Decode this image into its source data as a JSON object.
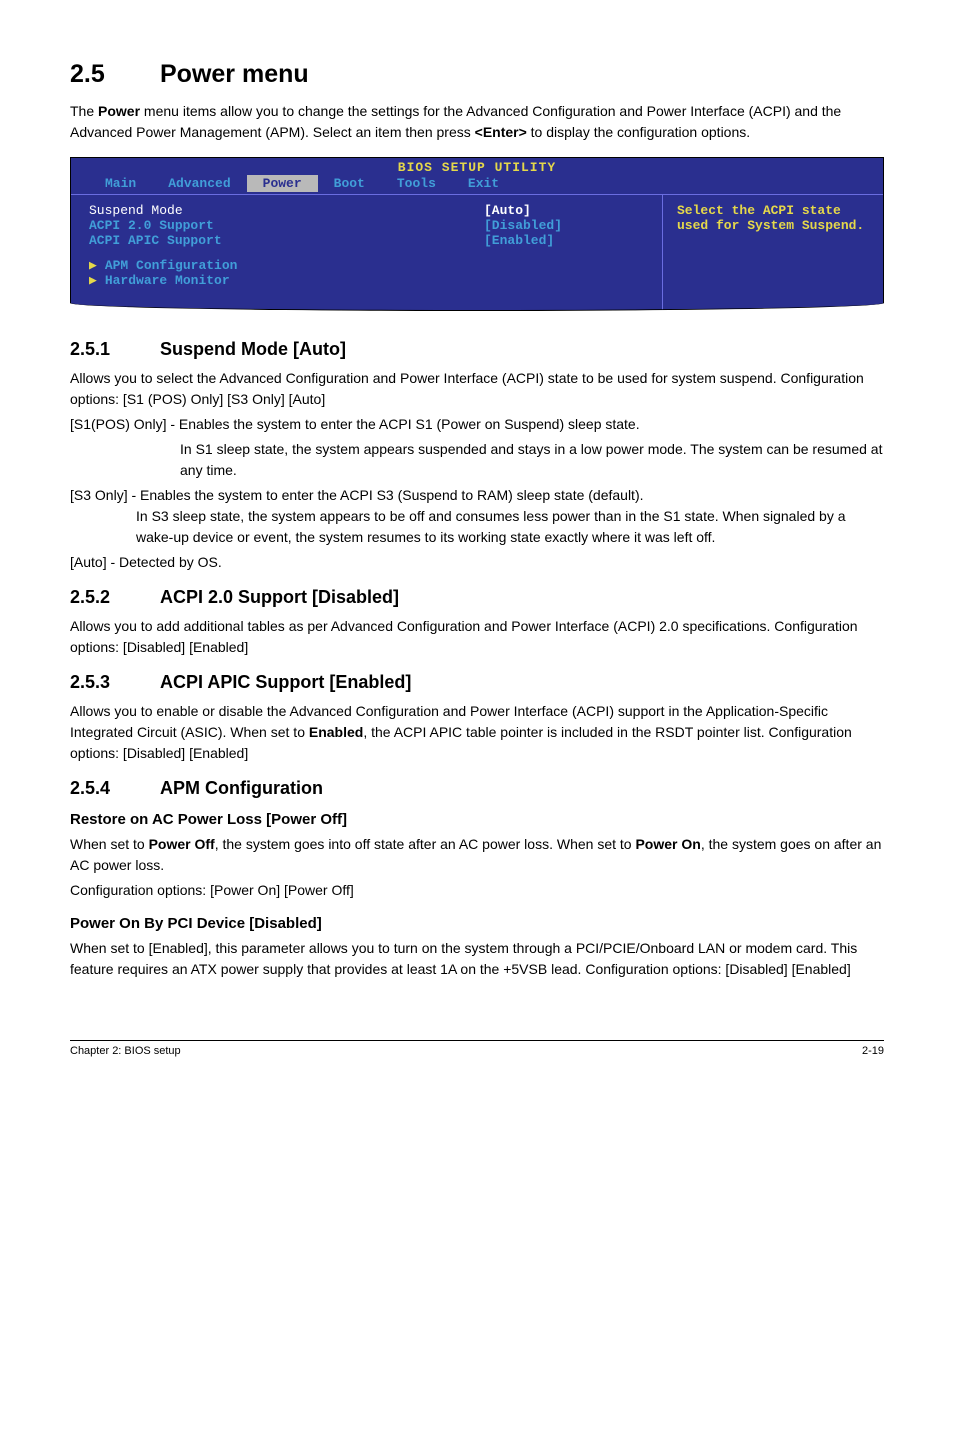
{
  "section": {
    "num": "2.5",
    "title": "Power menu"
  },
  "intro": "The Power menu items allow you to change the settings for the Advanced Configuration and Power Interface (ACPI) and the Advanced Power Management (APM). Select an item then press <Enter> to display the configuration options.",
  "bios": {
    "title": "BIOS SETUP UTILITY",
    "tabs": [
      "Main",
      "Advanced",
      "Power",
      "Boot",
      "Tools",
      "Exit"
    ],
    "active_tab_index": 2,
    "rows": [
      {
        "key": "Suspend Mode",
        "val": "[Auto]",
        "selected": true
      },
      {
        "key": "ACPI 2.0 Support",
        "val": "[Disabled]",
        "selected": false
      },
      {
        "key": "ACPI APIC Support",
        "val": "[Enabled]",
        "selected": false
      }
    ],
    "links": [
      "APM Configuration",
      "Hardware Monitor"
    ],
    "help": "Select the ACPI state used for System Suspend."
  },
  "s251": {
    "num": "2.5.1",
    "title": "Suspend Mode [Auto]",
    "p1": "Allows you to select the Advanced Configuration and Power Interface (ACPI) state to be used for system suspend. Configuration options: [S1 (POS) Only] [S3 Only] [Auto]",
    "s1_line1": "[S1(POS) Only] - Enables the system to enter the ACPI S1 (Power on Suspend) sleep state.",
    "s1_line2": "In S1 sleep state, the system appears suspended and stays in a low power mode. The system can be resumed at any time.",
    "s3_line1": "[S3 Only] - Enables the system to enter the ACPI S3 (Suspend to RAM) sleep state (default). In S3 sleep state, the system appears to be off and consumes less power than in the S1 state. When signaled by a wake-up device or event, the system resumes to its working state exactly where it was left off.",
    "auto": "[Auto] - Detected by OS."
  },
  "s252": {
    "num": "2.5.2",
    "title": "ACPI 2.0 Support [Disabled]",
    "p": "Allows you to add additional tables as per Advanced Configuration and Power Interface (ACPI) 2.0 specifications. Configuration options: [Disabled] [Enabled]"
  },
  "s253": {
    "num": "2.5.3",
    "title": "ACPI APIC Support [Enabled]",
    "p": "Allows you to enable or disable the Advanced Configuration and Power Interface (ACPI) support in the Application-Specific Integrated Circuit (ASIC). When set to Enabled, the ACPI APIC table pointer is included in the RSDT pointer list. Configuration options: [Disabled] [Enabled]"
  },
  "s254": {
    "num": "2.5.4",
    "title": "APM Configuration",
    "h1": "Restore on AC Power Loss [Power Off]",
    "p1a": "When set to Power Off, the system goes into off state after an AC power loss. When set to Power On, the system goes on after an AC power loss.",
    "p1b": "Configuration options: [Power On] [Power Off]",
    "h2": "Power On By PCI Device [Disabled]",
    "p2": "When set to [Enabled], this parameter allows you to turn on the system through a PCI/PCIE/Onboard LAN or modem card. This feature requires an ATX power supply that provides at least 1A on the +5VSB lead. Configuration options: [Disabled] [Enabled]"
  },
  "footer": {
    "left": "Chapter 2: BIOS setup",
    "right": "2-19"
  }
}
